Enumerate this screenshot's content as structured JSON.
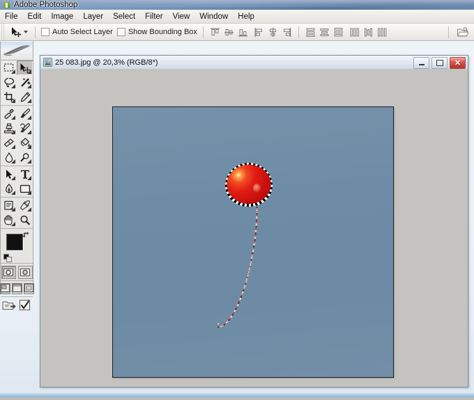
{
  "app": {
    "title": "Adobe Photoshop",
    "logo_icon": "photoshop-feather-icon"
  },
  "menu": {
    "items": [
      {
        "label": "File"
      },
      {
        "label": "Edit"
      },
      {
        "label": "Image"
      },
      {
        "label": "Layer"
      },
      {
        "label": "Select"
      },
      {
        "label": "Filter"
      },
      {
        "label": "View"
      },
      {
        "label": "Window"
      },
      {
        "label": "Help"
      }
    ]
  },
  "options_bar": {
    "active_tool": "Move Tool",
    "tool_preset_icon": "move-tool-icon",
    "tool_preset_dropdown_icon": "chevron-down-icon",
    "auto_select_layer": {
      "label": "Auto Select Layer",
      "checked": false
    },
    "show_bounding_box": {
      "label": "Show Bounding Box",
      "checked": false
    },
    "align_group": [
      {
        "name": "align-top-edges-icon"
      },
      {
        "name": "align-vertical-centers-icon"
      },
      {
        "name": "align-bottom-edges-icon"
      }
    ],
    "align_group2": [
      {
        "name": "align-left-edges-icon"
      },
      {
        "name": "align-horizontal-centers-icon"
      },
      {
        "name": "align-right-edges-icon"
      }
    ],
    "distribute_group": [
      {
        "name": "distribute-top-edges-icon"
      },
      {
        "name": "distribute-vertical-centers-icon"
      },
      {
        "name": "distribute-bottom-edges-icon"
      }
    ],
    "distribute_group2": [
      {
        "name": "distribute-left-edges-icon"
      },
      {
        "name": "distribute-horizontal-centers-icon"
      },
      {
        "name": "distribute-right-edges-icon"
      }
    ],
    "palette_well_icon": "palette-well-icon"
  },
  "toolbar": {
    "logo_icon": "photoshop-feather-icon",
    "tools": [
      {
        "name": "marquee-tool",
        "icon": "rectangular-marquee-icon",
        "active": false
      },
      {
        "name": "move-tool",
        "icon": "move-tool-icon",
        "active": true
      },
      {
        "name": "lasso-tool",
        "icon": "lasso-icon",
        "active": false
      },
      {
        "name": "magic-wand-tool",
        "icon": "magic-wand-icon",
        "active": false
      },
      {
        "name": "crop-tool",
        "icon": "crop-icon",
        "active": false
      },
      {
        "name": "slice-tool",
        "icon": "slice-icon",
        "active": false
      },
      {
        "name": "healing-brush-tool",
        "icon": "healing-brush-icon",
        "active": false
      },
      {
        "name": "brush-tool",
        "icon": "paintbrush-icon",
        "active": false
      },
      {
        "name": "clone-stamp-tool",
        "icon": "clone-stamp-icon",
        "active": false
      },
      {
        "name": "history-brush-tool",
        "icon": "history-brush-icon",
        "active": false
      },
      {
        "name": "eraser-tool",
        "icon": "eraser-icon",
        "active": false
      },
      {
        "name": "paint-bucket-tool",
        "icon": "paint-bucket-icon",
        "active": false
      },
      {
        "name": "blur-tool",
        "icon": "blur-droplet-icon",
        "active": false
      },
      {
        "name": "dodge-tool",
        "icon": "dodge-burn-icon",
        "active": false
      },
      {
        "name": "path-selection-tool",
        "icon": "path-arrow-icon",
        "active": false
      },
      {
        "name": "type-tool",
        "icon": "type-t-icon",
        "active": false
      },
      {
        "name": "pen-tool",
        "icon": "pen-nib-icon",
        "active": false
      },
      {
        "name": "shape-tool",
        "icon": "rectangle-shape-icon",
        "active": false
      },
      {
        "name": "notes-tool",
        "icon": "notes-icon",
        "active": false
      },
      {
        "name": "eyedropper-tool",
        "icon": "eyedropper-icon",
        "active": false
      },
      {
        "name": "hand-tool",
        "icon": "hand-icon",
        "active": false
      },
      {
        "name": "zoom-tool",
        "icon": "magnifier-icon",
        "active": false
      }
    ],
    "colors": {
      "foreground": "#111111",
      "background": "#c9c8c4",
      "swap_icon": "swap-colors-icon",
      "default_icon": "default-colors-icon"
    },
    "quick_mask": [
      {
        "name": "standard-mode-button",
        "active": true
      },
      {
        "name": "quick-mask-mode-button",
        "active": false
      }
    ],
    "screen_modes": [
      {
        "name": "standard-screen-mode-button",
        "active": true
      },
      {
        "name": "full-screen-with-menubar-button",
        "active": false
      },
      {
        "name": "full-screen-mode-button",
        "active": false
      }
    ],
    "jump_to": [
      {
        "name": "jump-to-imageready-button"
      },
      {
        "name": "imageready-check-button"
      }
    ]
  },
  "document": {
    "title": "25 083.jpg @ 20,3% (RGB/8*)",
    "filename": "25 083.jpg",
    "zoom": "20,3%",
    "color_mode": "RGB/8*",
    "icon": "document-thumbnail-icon",
    "window_buttons": [
      {
        "name": "minimize-button",
        "icon": "minimize-icon"
      },
      {
        "name": "maximize-button",
        "icon": "maximize-icon"
      },
      {
        "name": "close-button",
        "icon": "close-icon"
      }
    ],
    "canvas": {
      "sky_color": "#6e8ca5",
      "balloon_color": "#e01d14",
      "balloon_highlight": "#ffe9a8",
      "string_colors": [
        "#d94a4a",
        "#f2f2f2",
        "#2a2a2a"
      ],
      "selection": "marching-ants-around-balloon"
    }
  }
}
